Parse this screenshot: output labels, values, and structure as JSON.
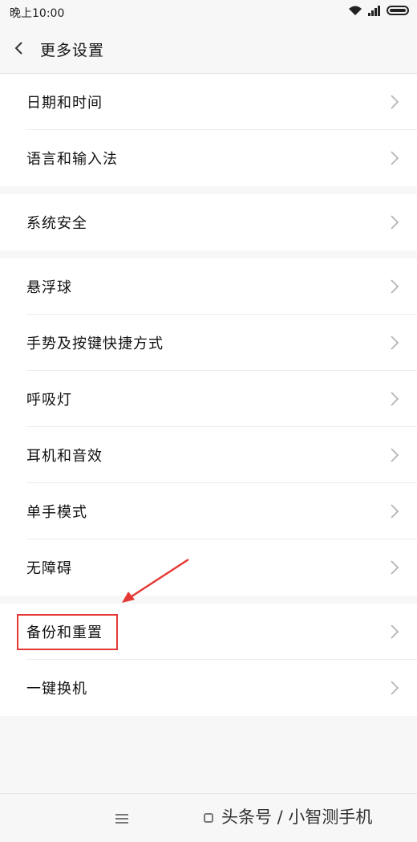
{
  "status_bar": {
    "time": "晚上10:00",
    "icons": [
      "wifi-icon",
      "signal-icon",
      "battery-icon"
    ]
  },
  "header": {
    "title": "更多设置",
    "back_icon": "chevron-left-icon"
  },
  "groups": [
    {
      "items": [
        {
          "label": "日期和时间"
        },
        {
          "label": "语言和输入法"
        }
      ]
    },
    {
      "items": [
        {
          "label": "系统安全"
        }
      ]
    },
    {
      "items": [
        {
          "label": "悬浮球"
        },
        {
          "label": "手势及按键快捷方式"
        },
        {
          "label": "呼吸灯"
        },
        {
          "label": "耳机和音效"
        },
        {
          "label": "单手模式"
        },
        {
          "label": "无障碍"
        }
      ]
    },
    {
      "items": [
        {
          "label": "备份和重置"
        },
        {
          "label": "一键换机"
        }
      ]
    }
  ],
  "annotation": {
    "highlight_color": "#e53935",
    "highlighted_item": "备份和重置"
  },
  "nav_bar": {
    "watermark": "头条号 / 小智测手机",
    "icons": [
      "menu-icon",
      "home-icon"
    ]
  },
  "colors": {
    "background": "#f7f7f7",
    "card": "#ffffff",
    "text": "#111111",
    "chevron": "#b5b5b5"
  }
}
